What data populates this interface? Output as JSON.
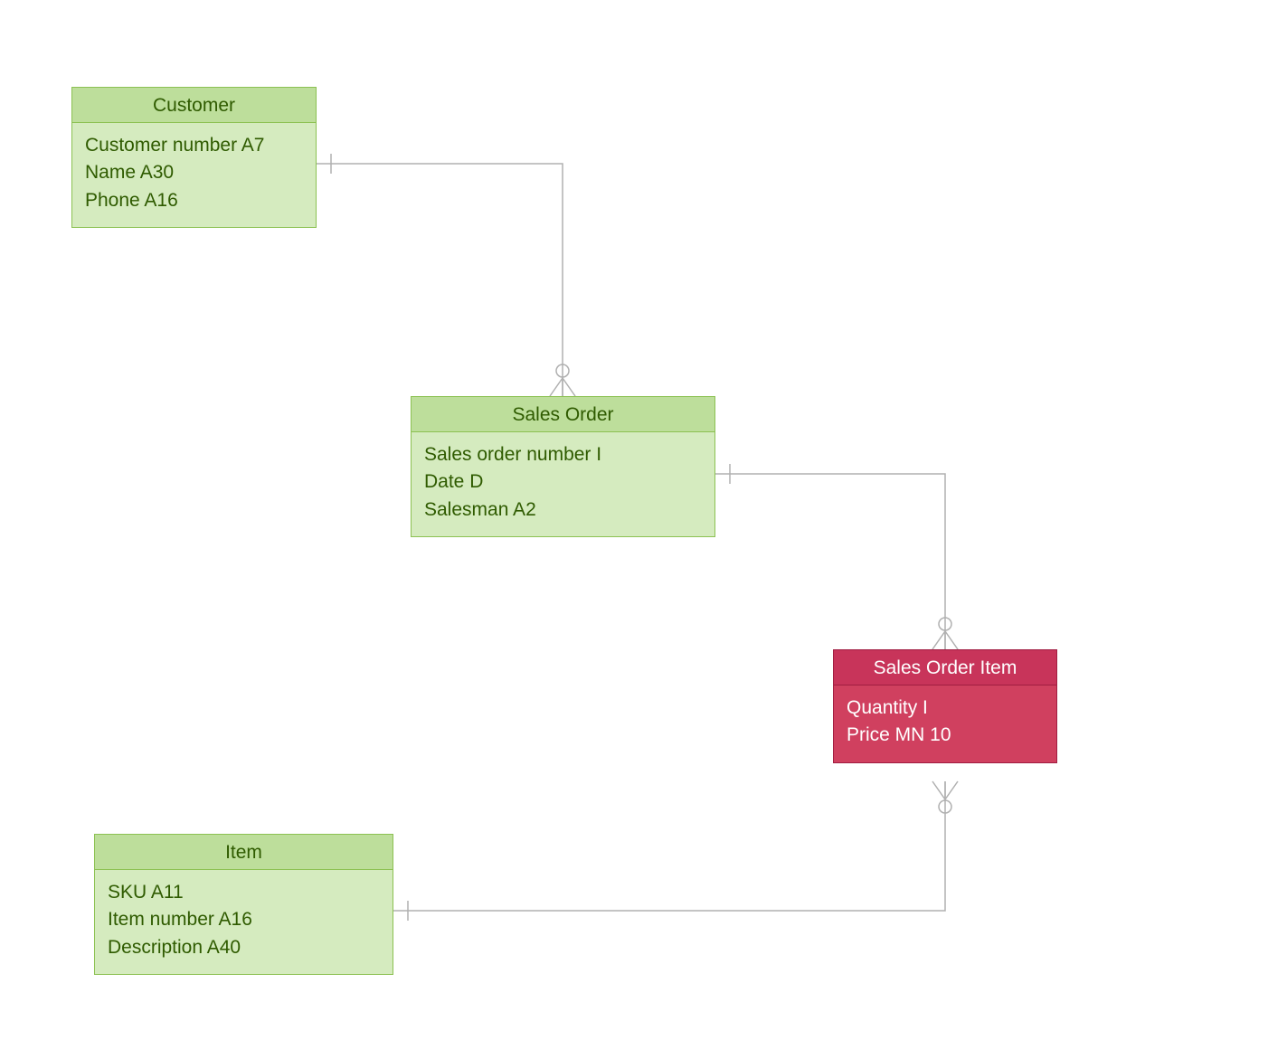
{
  "entities": {
    "customer": {
      "title": "Customer",
      "attributes": [
        "Customer number  A7",
        "Name A30",
        "Phone A16"
      ]
    },
    "sales_order": {
      "title": "Sales Order",
      "attributes": [
        "Sales order number I",
        "Date D",
        "Salesman A2"
      ]
    },
    "sales_order_item": {
      "title": "Sales Order Item",
      "attributes": [
        "Quantity I",
        "Price MN 10"
      ]
    },
    "item": {
      "title": "Item",
      "attributes": [
        "SKU A11",
        "Item number A16",
        "Description A40"
      ]
    }
  }
}
